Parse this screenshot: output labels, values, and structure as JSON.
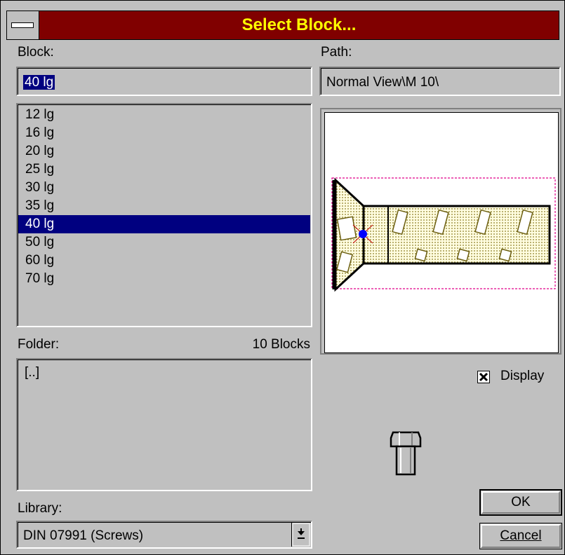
{
  "title": "Select Block...",
  "block": {
    "label": "Block:",
    "value": "40 lg"
  },
  "path": {
    "label": "Path:",
    "value": "Normal View\\M 10\\"
  },
  "list": {
    "items": [
      "12 lg",
      "16 lg",
      "20 lg",
      "25 lg",
      "30 lg",
      "35 lg",
      "40 lg",
      "50 lg",
      "60 lg",
      "70 lg"
    ],
    "selected": "40 lg"
  },
  "folder": {
    "label": "Folder:",
    "count": "10 Blocks",
    "items": [
      "[..]"
    ]
  },
  "library": {
    "label": "Library:",
    "value": "DIN 07991 (Screws)"
  },
  "display": {
    "label": "Display",
    "checked": true
  },
  "buttons": {
    "ok": "OK",
    "cancel": "Cancel"
  },
  "icons": {
    "system_menu": "minus-icon",
    "dropdown": "arrow-down-icon",
    "block_type": "bolt-icon"
  }
}
